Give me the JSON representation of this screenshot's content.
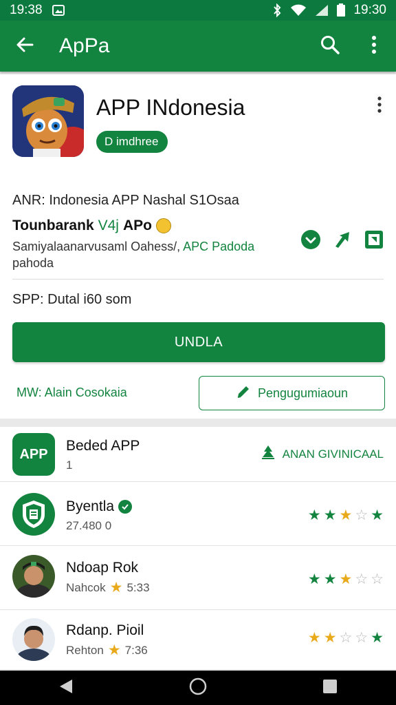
{
  "status_bar": {
    "time_left": "19:38",
    "time_right": "19:30",
    "icons": [
      "image-icon",
      "bluetooth-icon",
      "wifi-icon",
      "signal-icon",
      "battery-icon"
    ]
  },
  "app_bar": {
    "title": "ApPa",
    "back_icon": "arrow-left-icon",
    "search_icon": "search-icon",
    "menu_icon": "more-vertical-icon"
  },
  "app": {
    "title": "APP INdonesia",
    "chip_label": "D  imdhree",
    "meta_line": "ANR: Indonesia APP Nashal S1Osaa",
    "developer_bold": "Tounbarank",
    "developer_green": "V4j",
    "developer_tail": "APo",
    "description": "Samiyalaanarvusaml Oahess/,",
    "description_link": "APC Padoda",
    "description_2": "pahoda",
    "size_line": "SPP: Dutal i60 som",
    "primary_button": "UNDLA",
    "mw_label": "MW:",
    "mw_value": "Alain Cosokaia",
    "secondary_button": "Pengugumiaoun"
  },
  "list": [
    {
      "name": "Beded APP",
      "sub": "1",
      "badge_text": "APP",
      "right_label": "ANAN GIVINICAAL"
    },
    {
      "name": "Byentla",
      "sub": "27.480 0",
      "stars": [
        "green",
        "green",
        "gold",
        "empty",
        "green"
      ]
    },
    {
      "name": "Ndoap Rok",
      "sub_label": "Nahcok",
      "sub_value": "5:33",
      "stars": [
        "green",
        "green",
        "gold",
        "empty",
        "empty"
      ]
    },
    {
      "name": "Rdanp. Pioil",
      "sub_label": "Rehton",
      "sub_value": "7:36",
      "stars": [
        "gold",
        "gold",
        "empty",
        "empty",
        "green"
      ]
    }
  ],
  "colors": {
    "brand_green": "#13843f",
    "star_gold": "#e8a91b"
  }
}
